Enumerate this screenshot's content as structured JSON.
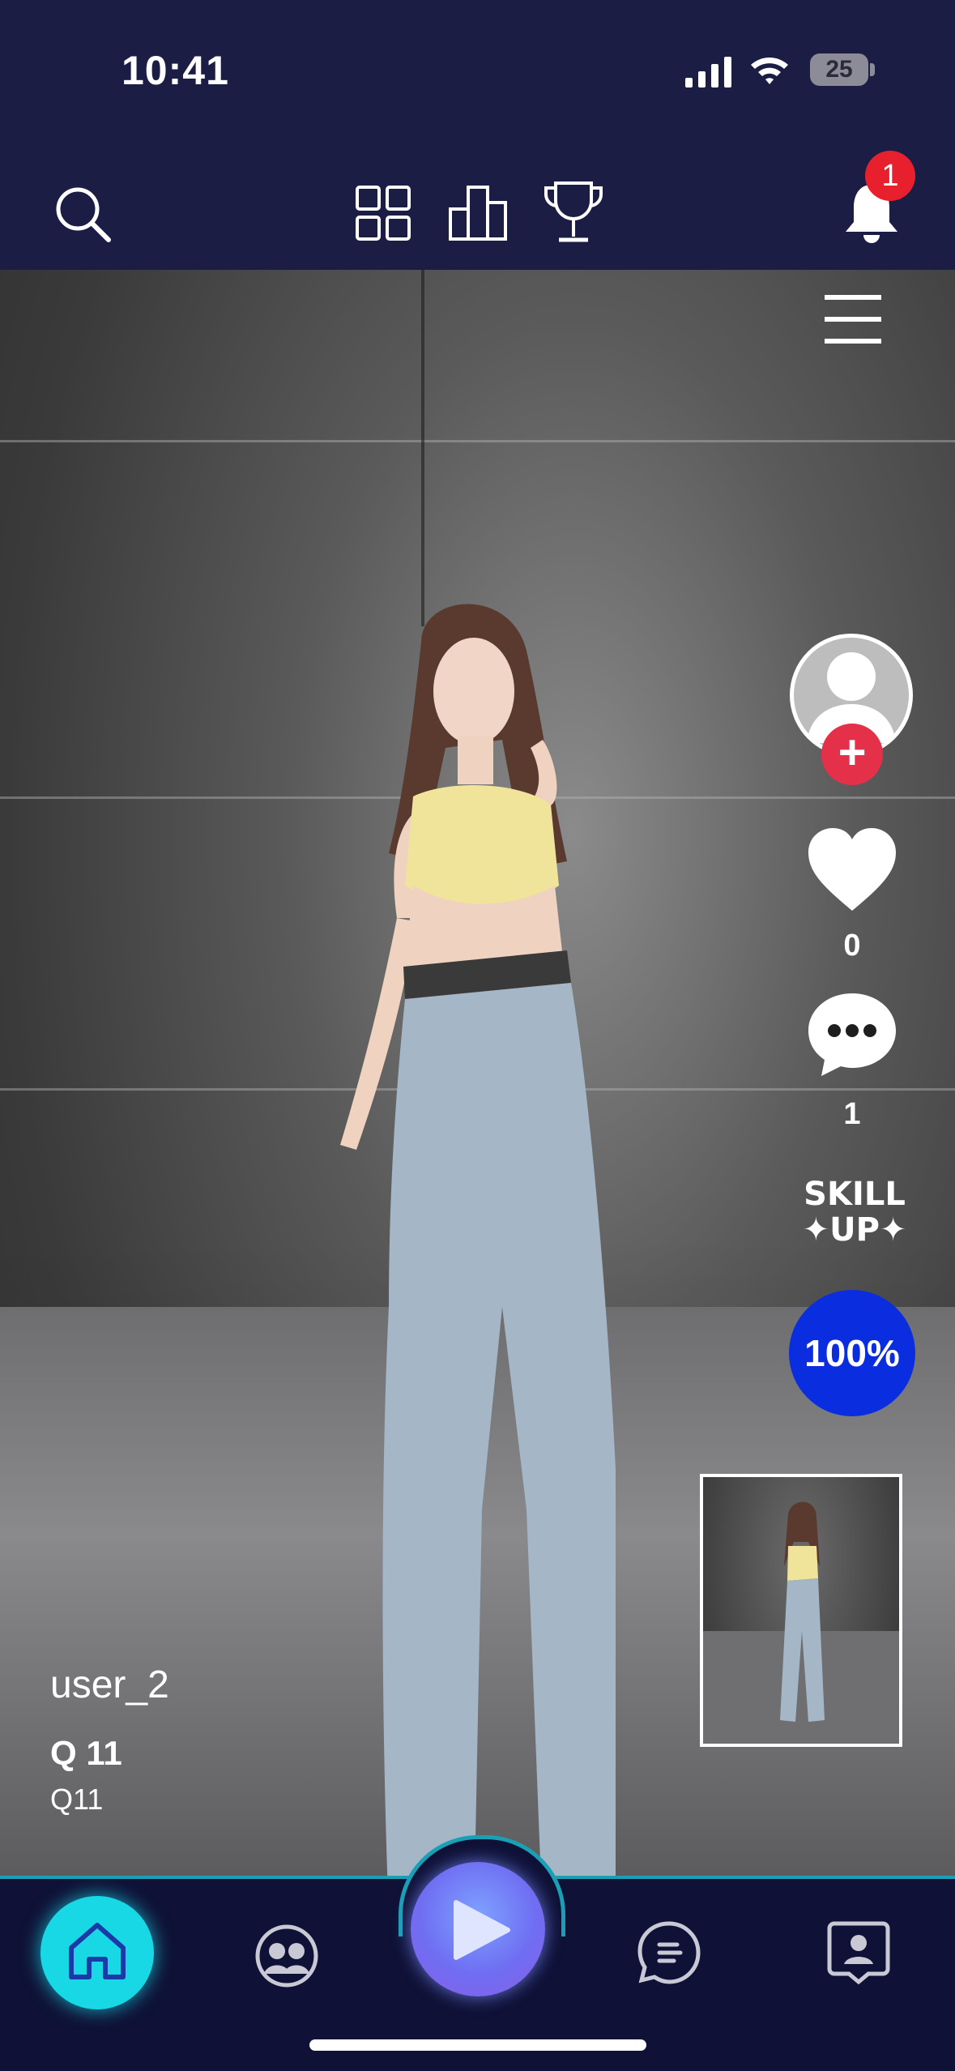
{
  "status_bar": {
    "time": "10:41",
    "battery": "25"
  },
  "top_bar": {
    "notification_count": "1"
  },
  "video": {
    "likes": "0",
    "comments": "1",
    "skill_up_line1": "SKILL",
    "skill_up_line2": "✦UP✦",
    "progress": "100%",
    "username": "user_2",
    "title": "Q 11",
    "subtitle": "Q11"
  },
  "colors": {
    "background": "#1c1d45",
    "accent_cyan": "#19d8e6",
    "progress_blue": "#0a2de0",
    "follow_red": "#e5304a",
    "badge_red": "#e8202e"
  }
}
